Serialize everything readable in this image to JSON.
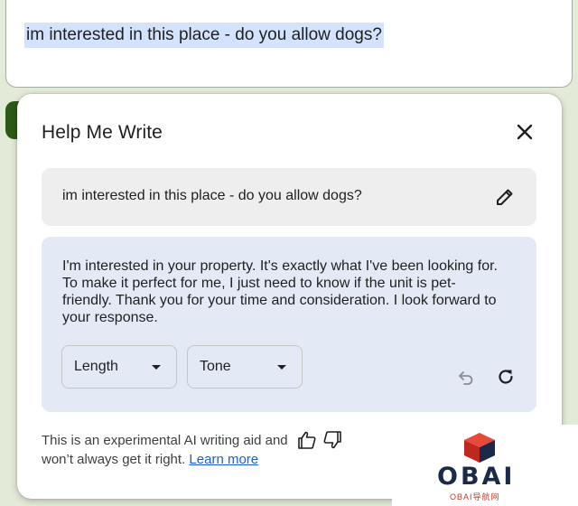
{
  "compose": {
    "text": "im interested in this place - do you allow dogs?"
  },
  "dialog": {
    "title": "Help Me Write",
    "close_icon": "close-icon",
    "prompt": {
      "text": "im interested in this place - do you allow dogs?",
      "edit_icon": "pencil-icon"
    },
    "result": {
      "text": "I'm interested in your property. It's exactly what I've been looking for. To make it perfect for me, I just need to know if the unit is pet-friendly. Thank you for your time and consideration. I look forward to your response."
    },
    "controls": {
      "length_label": "Length",
      "tone_label": "Tone",
      "undo_icon": "undo-icon",
      "redo_icon": "redo-icon"
    },
    "footer": {
      "disclaimer": "This is an experimental AI writing aid and won’t always get it right.",
      "learn_more": "Learn more",
      "thumbs_up_icon": "thumbs-up-icon",
      "thumbs_down_icon": "thumbs-down-icon"
    }
  },
  "watermark": {
    "brand": "OBAI",
    "subtitle": "OBAI导航网"
  },
  "colors": {
    "background": "#e4ead8",
    "selection": "#d3e3fd",
    "result_bg": "#e3eaf6",
    "prompt_bg": "#eeeeee",
    "link": "#1a5fd6"
  }
}
